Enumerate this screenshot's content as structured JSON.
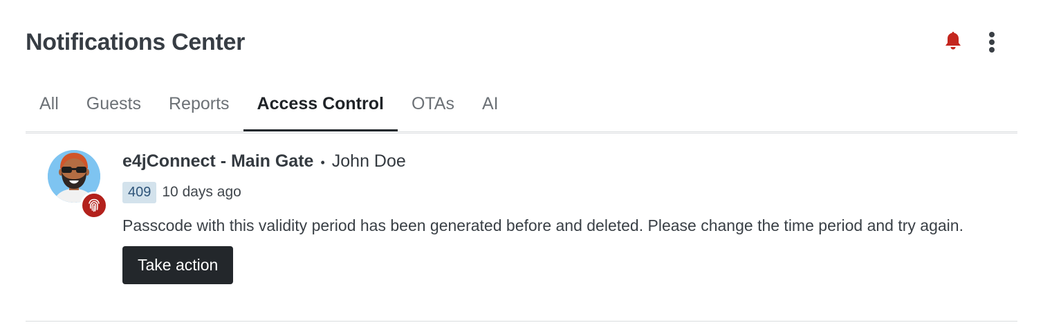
{
  "header": {
    "title": "Notifications Center",
    "bell_icon": "bell-icon",
    "bell_color": "#c4261e",
    "more_icon": "kebab-menu-icon"
  },
  "tabs": [
    {
      "label": "All",
      "active": false
    },
    {
      "label": "Guests",
      "active": false
    },
    {
      "label": "Reports",
      "active": false
    },
    {
      "label": "Access Control",
      "active": true
    },
    {
      "label": "OTAs",
      "active": false
    },
    {
      "label": "AI",
      "active": false
    }
  ],
  "notifications": [
    {
      "source": "e4jConnect - Main Gate",
      "separator": "•",
      "user": "John Doe",
      "code": "409",
      "time": "10 days ago",
      "message": "Passcode with this validity period has been generated before and deleted. Please change the time period and try again.",
      "action_label": "Take action",
      "avatar_icon": "user-avatar",
      "badge_icon": "fingerprint-icon",
      "badge_color": "#b3211c"
    }
  ]
}
